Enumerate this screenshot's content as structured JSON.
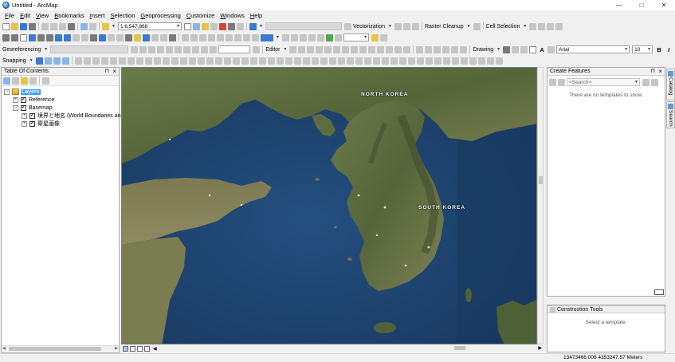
{
  "window": {
    "title": "Untitled - ArcMap",
    "controls": [
      "—",
      "□",
      "✕"
    ]
  },
  "menu": [
    {
      "label": "File",
      "key": "F",
      "rest": "ile"
    },
    {
      "label": "Edit",
      "key": "E",
      "rest": "dit"
    },
    {
      "label": "View",
      "key": "V",
      "rest": "iew"
    },
    {
      "label": "Bookmarks",
      "key": "B",
      "rest": "ookmarks"
    },
    {
      "label": "Insert",
      "key": "I",
      "rest": "nsert"
    },
    {
      "label": "Selection",
      "key": "S",
      "rest": "election"
    },
    {
      "label": "Geoprocessing",
      "key": "G",
      "rest": "eoprocessing"
    },
    {
      "label": "Customize",
      "key": "C",
      "rest": "ustomize"
    },
    {
      "label": "Windows",
      "key": "W",
      "rest": "indows"
    },
    {
      "label": "Help",
      "key": "H",
      "rest": "elp"
    }
  ],
  "toolbar": {
    "scale_value": "1:6,547,868",
    "vectorization_label": "Vectorization",
    "raster_cleanup_label": "Raster Cleanup",
    "cell_selection_label": "Cell Selection",
    "georeferencing_label": "Georeferencing",
    "editor_label": "Editor",
    "drawing_label": "Drawing",
    "font_name": "Arial",
    "font_size": "10",
    "bold": "B",
    "italic": "I",
    "underline": "U",
    "font_color_glyph": "A",
    "snapping_label": "Snapping"
  },
  "toc": {
    "title": "Table Of Contents",
    "pin": "⊓",
    "close": "×",
    "layers_label": "Layers",
    "items": [
      {
        "label": "Reference",
        "checked": "✓",
        "expander": "+"
      },
      {
        "label": "Basemap",
        "checked": "✓",
        "expander": "−"
      },
      {
        "label": "境界と地名 (World Boundaries and Places)",
        "checked": "✓",
        "expander": "+"
      },
      {
        "label": "衛星画像",
        "checked": "✓",
        "expander": "+"
      }
    ]
  },
  "map": {
    "labels": {
      "north_korea": "NORTH KOREA",
      "south_korea": "SOUTH KOREA"
    },
    "colors": {
      "sea": "#1d4f7d",
      "deep_sea": "#1a3f68",
      "land": "#5c6b3d",
      "land_dry": "#8a8557",
      "mountain": "#3f4e2c"
    }
  },
  "create_features": {
    "title": "Create Features",
    "search_placeholder": "<Search>",
    "empty_message": "There are no templates to show."
  },
  "construction_tools": {
    "title": "Construction Tools",
    "message": "Select a template."
  },
  "side_tabs": [
    "Catalog",
    "Search"
  ],
  "status": {
    "coordinates": "13473466.006  4353247.57 Meters"
  }
}
